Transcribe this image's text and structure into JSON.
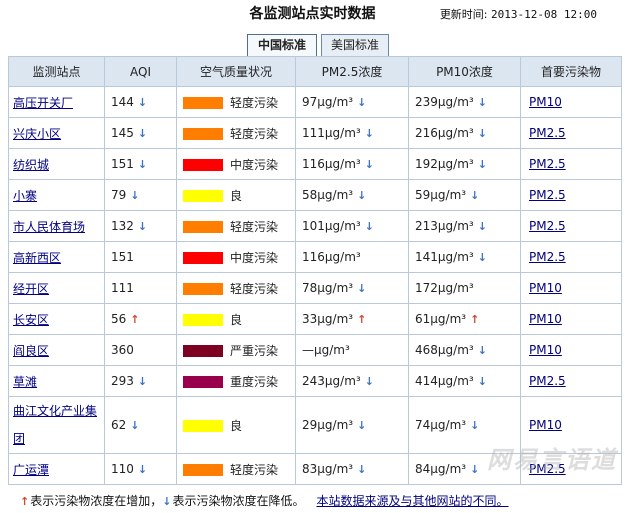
{
  "header": {
    "title": "各监测站点实时数据",
    "update_label": "更新时间:",
    "update_time": "2013-12-08 12:00"
  },
  "tabs": [
    {
      "label": "中国标准",
      "active": true
    },
    {
      "label": "美国标准",
      "active": false
    }
  ],
  "table": {
    "columns": [
      "监测站点",
      "AQI",
      "空气质量状况",
      "PM2.5浓度",
      "PM10浓度",
      "首要污染物"
    ],
    "rows": [
      {
        "station": "高压开关厂",
        "aqi": "144",
        "aqi_trend": "down",
        "quality": "轻度污染",
        "color": "#ff7e00",
        "pm25": "97μg/m³",
        "pm25_trend": "down",
        "pm10": "239μg/m³",
        "pm10_trend": "down",
        "pollutant": "PM10"
      },
      {
        "station": "兴庆小区",
        "aqi": "145",
        "aqi_trend": "down",
        "quality": "轻度污染",
        "color": "#ff7e00",
        "pm25": "111μg/m³",
        "pm25_trend": "down",
        "pm10": "216μg/m³",
        "pm10_trend": "down",
        "pollutant": "PM2.5"
      },
      {
        "station": "纺织城",
        "aqi": "151",
        "aqi_trend": "down",
        "quality": "中度污染",
        "color": "#ff0000",
        "pm25": "116μg/m³",
        "pm25_trend": "down",
        "pm10": "192μg/m³",
        "pm10_trend": "down",
        "pollutant": "PM2.5"
      },
      {
        "station": "小寨",
        "aqi": "79",
        "aqi_trend": "down",
        "quality": "良",
        "color": "#ffff00",
        "pm25": "58μg/m³",
        "pm25_trend": "down",
        "pm10": "59μg/m³",
        "pm10_trend": "down",
        "pollutant": "PM2.5"
      },
      {
        "station": "市人民体育场",
        "aqi": "132",
        "aqi_trend": "down",
        "quality": "轻度污染",
        "color": "#ff7e00",
        "pm25": "101μg/m³",
        "pm25_trend": "down",
        "pm10": "213μg/m³",
        "pm10_trend": "down",
        "pollutant": "PM2.5"
      },
      {
        "station": "高新西区",
        "aqi": "151",
        "aqi_trend": "",
        "quality": "中度污染",
        "color": "#ff0000",
        "pm25": "116μg/m³",
        "pm25_trend": "",
        "pm10": "141μg/m³",
        "pm10_trend": "down",
        "pollutant": "PM2.5"
      },
      {
        "station": "经开区",
        "aqi": "111",
        "aqi_trend": "",
        "quality": "轻度污染",
        "color": "#ff7e00",
        "pm25": "78μg/m³",
        "pm25_trend": "down",
        "pm10": "172μg/m³",
        "pm10_trend": "",
        "pollutant": "PM10"
      },
      {
        "station": "长安区",
        "aqi": "56",
        "aqi_trend": "up",
        "quality": "良",
        "color": "#ffff00",
        "pm25": "33μg/m³",
        "pm25_trend": "up",
        "pm10": "61μg/m³",
        "pm10_trend": "up",
        "pollutant": "PM10"
      },
      {
        "station": "阎良区",
        "aqi": "360",
        "aqi_trend": "",
        "quality": "严重污染",
        "color": "#7e0023",
        "pm25": "—μg/m³",
        "pm25_trend": "",
        "pm10": "468μg/m³",
        "pm10_trend": "down",
        "pollutant": "PM10"
      },
      {
        "station": "草滩",
        "aqi": "293",
        "aqi_trend": "down",
        "quality": "重度污染",
        "color": "#99004c",
        "pm25": "243μg/m³",
        "pm25_trend": "down",
        "pm10": "414μg/m³",
        "pm10_trend": "down",
        "pollutant": "PM2.5"
      },
      {
        "station": "曲江文化产业集团",
        "aqi": "62",
        "aqi_trend": "down",
        "quality": "良",
        "color": "#ffff00",
        "pm25": "29μg/m³",
        "pm25_trend": "down",
        "pm10": "74μg/m³",
        "pm10_trend": "down",
        "pollutant": "PM10"
      },
      {
        "station": "广运潭",
        "aqi": "110",
        "aqi_trend": "down",
        "quality": "轻度污染",
        "color": "#ff7e00",
        "pm25": "83μg/m³",
        "pm25_trend": "down",
        "pm10": "84μg/m³",
        "pm10_trend": "down",
        "pollutant": "PM2.5"
      }
    ]
  },
  "legend": {
    "up_text": "表示污染物浓度在增加，",
    "down_text": "表示污染物浓度在降低。",
    "link": "本站数据来源及与其他网站的不同。"
  },
  "icons": {
    "up": "arrow-up-icon",
    "down": "arrow-down-icon"
  }
}
